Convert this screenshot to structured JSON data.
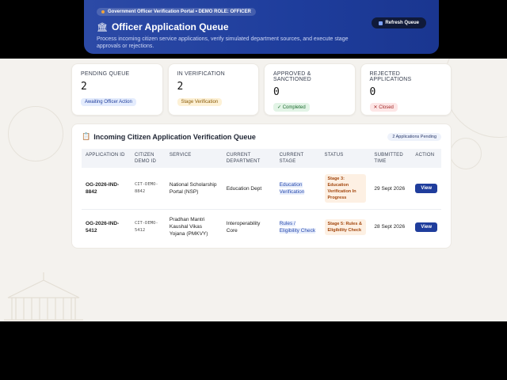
{
  "hero": {
    "chip": "Government Officer Verification Portal • DEMO ROLE: OFFICER",
    "title": "Officer Application Queue",
    "description": "Process incoming citizen service applications, verify simulated department sources, and execute stage approvals or rejections.",
    "refresh_label": "Refresh Queue"
  },
  "stats": [
    {
      "label": "PENDING QUEUE",
      "value": "2",
      "badge": "Awaiting Officer Action",
      "color": "blue"
    },
    {
      "label": "IN VERIFICATION",
      "value": "2",
      "badge": "Stage Verification",
      "color": "amber"
    },
    {
      "label": "APPROVED & SANCTIONED",
      "value": "0",
      "badge": "✓ Completed",
      "color": "green"
    },
    {
      "label": "REJECTED APPLICATIONS",
      "value": "0",
      "badge": "✕ Closed",
      "color": "red"
    }
  ],
  "queue": {
    "title": "Incoming Citizen Application Verification Queue",
    "pending_label": "2 Applications Pending",
    "columns": [
      "APPLICATION ID",
      "CITIZEN DEMO ID",
      "SERVICE",
      "CURRENT DEPARTMENT",
      "CURRENT STAGE",
      "STATUS",
      "SUBMITTED TIME",
      "ACTION"
    ],
    "rows": [
      {
        "app_id": "OG-2026-IND-8842",
        "citizen_id": "CIT-DEMO-8842",
        "service": "National Scholarship Portal (NSP)",
        "department": "Education Dept",
        "stage": "Education Verification",
        "status": "Stage 3: Education Verification In Progress",
        "submitted": "29 Sept 2026",
        "action": "View"
      },
      {
        "app_id": "OG-2026-IND-5412",
        "citizen_id": "CIT-DEMO-5412",
        "service": "Pradhan Mantri Kaushal Vikas Yojana (PMKVY)",
        "department": "Interoperability Core",
        "stage": "Rules / Eligibility Check",
        "status": "Stage 5: Rules & Eligibility Check",
        "submitted": "28 Sept 2026",
        "action": "View"
      }
    ]
  }
}
